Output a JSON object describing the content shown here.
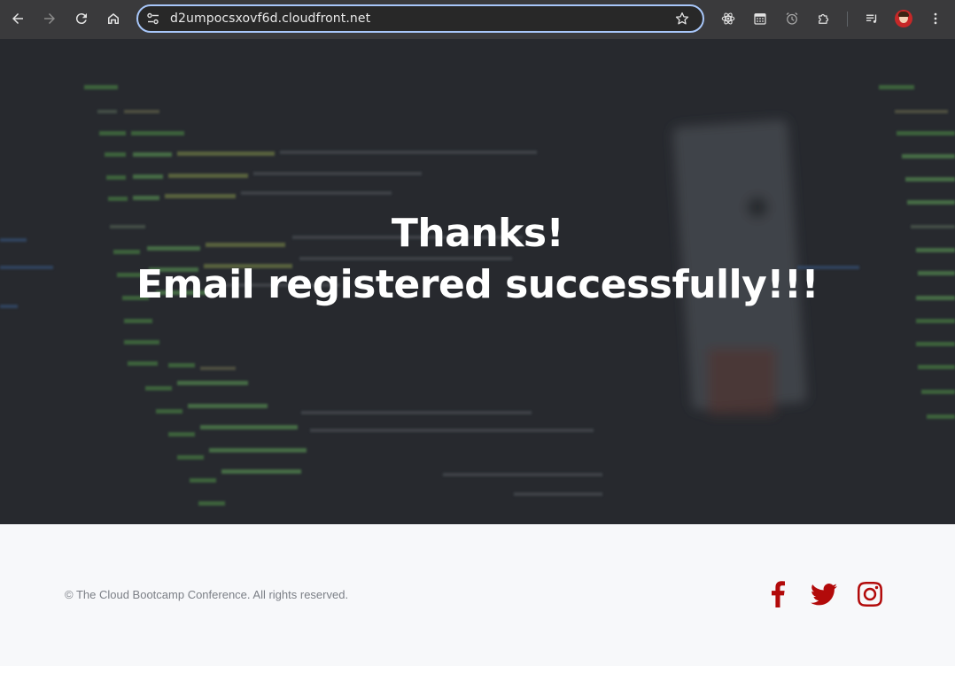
{
  "browser": {
    "url": "d2umpocsxovf6d.cloudfront.net",
    "icons": {
      "back": "arrow-left-icon",
      "forward": "arrow-right-icon",
      "reload": "reload-icon",
      "home": "home-icon",
      "site_info": "tune-icon",
      "bookmark": "star-icon",
      "extension_react": "react-icon",
      "extension_calendar": "calendar-icon",
      "extension_alarm": "alarm-icon",
      "extensions": "puzzle-icon",
      "media": "queue-music-icon",
      "profile": "avatar",
      "menu": "kebab-menu-icon"
    }
  },
  "hero": {
    "line1": "Thanks!",
    "line2": "Email registered successfully!!!"
  },
  "footer": {
    "copyright": "© The Cloud Bootcamp Conference. All rights reserved.",
    "social": [
      "facebook-icon",
      "twitter-icon",
      "instagram-icon"
    ],
    "accent_color": "#b20a0a"
  }
}
